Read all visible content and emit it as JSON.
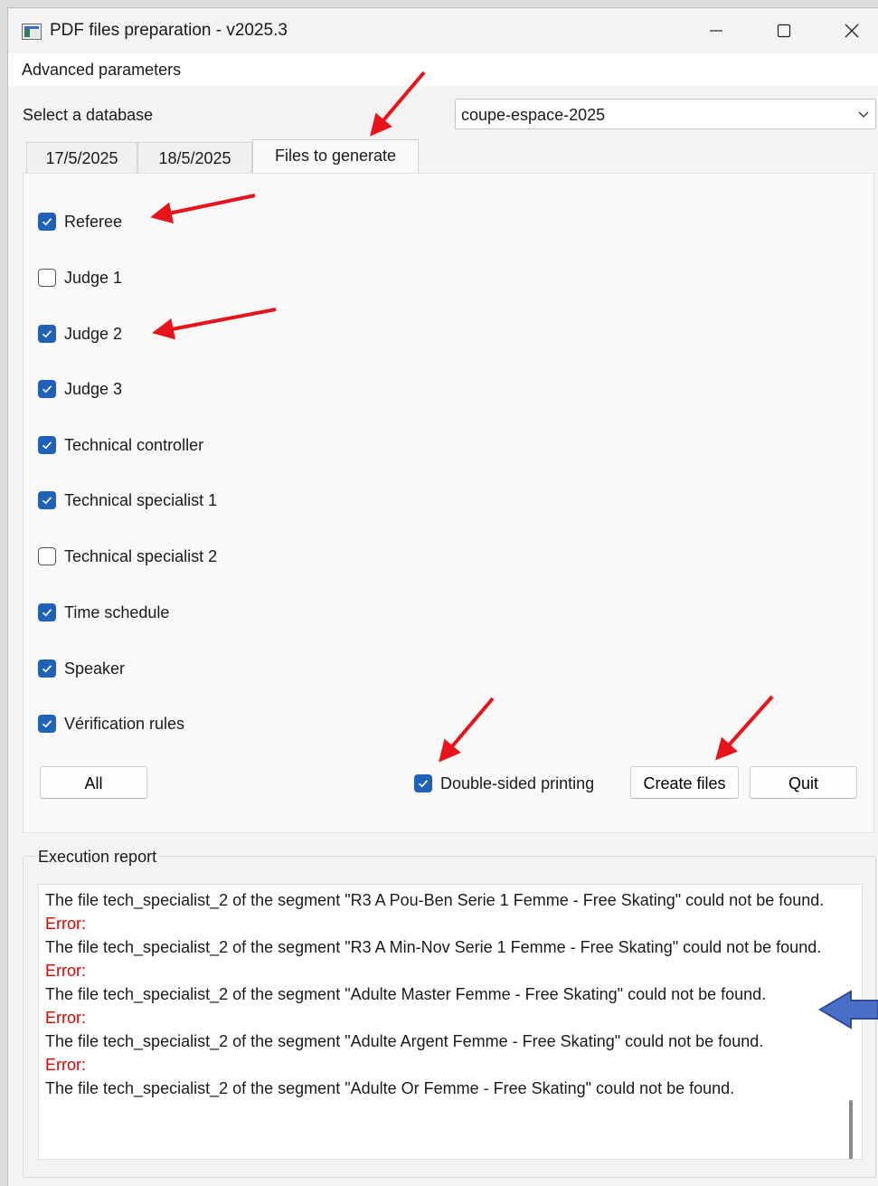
{
  "window": {
    "title": "PDF files preparation - v2025.3",
    "controls": {
      "minimize": "─",
      "maximize": "☐",
      "close": "✕"
    }
  },
  "menubar": {
    "advanced": "Advanced parameters"
  },
  "database": {
    "label": "Select a database",
    "selected": "coupe-espace-2025"
  },
  "tabs": [
    {
      "label": "17/5/2025",
      "active": false
    },
    {
      "label": "18/5/2025",
      "active": false
    },
    {
      "label": "Files to generate",
      "active": true
    }
  ],
  "files": [
    {
      "label": "Referee",
      "checked": true
    },
    {
      "label": "Judge 1",
      "checked": false
    },
    {
      "label": "Judge 2",
      "checked": true
    },
    {
      "label": "Judge 3",
      "checked": true
    },
    {
      "label": "Technical controller",
      "checked": true
    },
    {
      "label": "Technical specialist 1",
      "checked": true
    },
    {
      "label": "Technical specialist 2",
      "checked": false
    },
    {
      "label": "Time schedule",
      "checked": true
    },
    {
      "label": "Speaker",
      "checked": true
    },
    {
      "label": "Vérification rules",
      "checked": true
    }
  ],
  "actions": {
    "all": "All",
    "double_sided": {
      "label": "Double-sided printing",
      "checked": true
    },
    "create": "Create files",
    "quit": "Quit"
  },
  "report": {
    "title": "Execution report",
    "lines": [
      {
        "type": "msg",
        "text": "The file tech_specialist_2 of the segment \"R3 A Pou-Ben Serie 1 Femme - Free Skating\" could not be found."
      },
      {
        "type": "error",
        "text": "Error:"
      },
      {
        "type": "msg",
        "text": "The file tech_specialist_2 of the segment \"R3 A Min-Nov Serie 1 Femme - Free Skating\" could not be found."
      },
      {
        "type": "error",
        "text": "Error:"
      },
      {
        "type": "msg",
        "text": "The file tech_specialist_2 of the segment \"Adulte Master Femme - Free Skating\" could not be found."
      },
      {
        "type": "error",
        "text": "Error:"
      },
      {
        "type": "msg",
        "text": "The file tech_specialist_2 of the segment \"Adulte Argent Femme - Free Skating\" could not be found."
      },
      {
        "type": "error",
        "text": "Error:"
      },
      {
        "type": "msg",
        "text": "The file tech_specialist_2 of the segment \"Adulte Or Femme - Free Skating\" could not be found."
      }
    ]
  },
  "colors": {
    "checkbox_accent": "#1f62b8",
    "error_text": "#e10000",
    "annotation_red_arrow": "#e8141b",
    "annotation_blue_arrow": "#4a6fc8"
  }
}
